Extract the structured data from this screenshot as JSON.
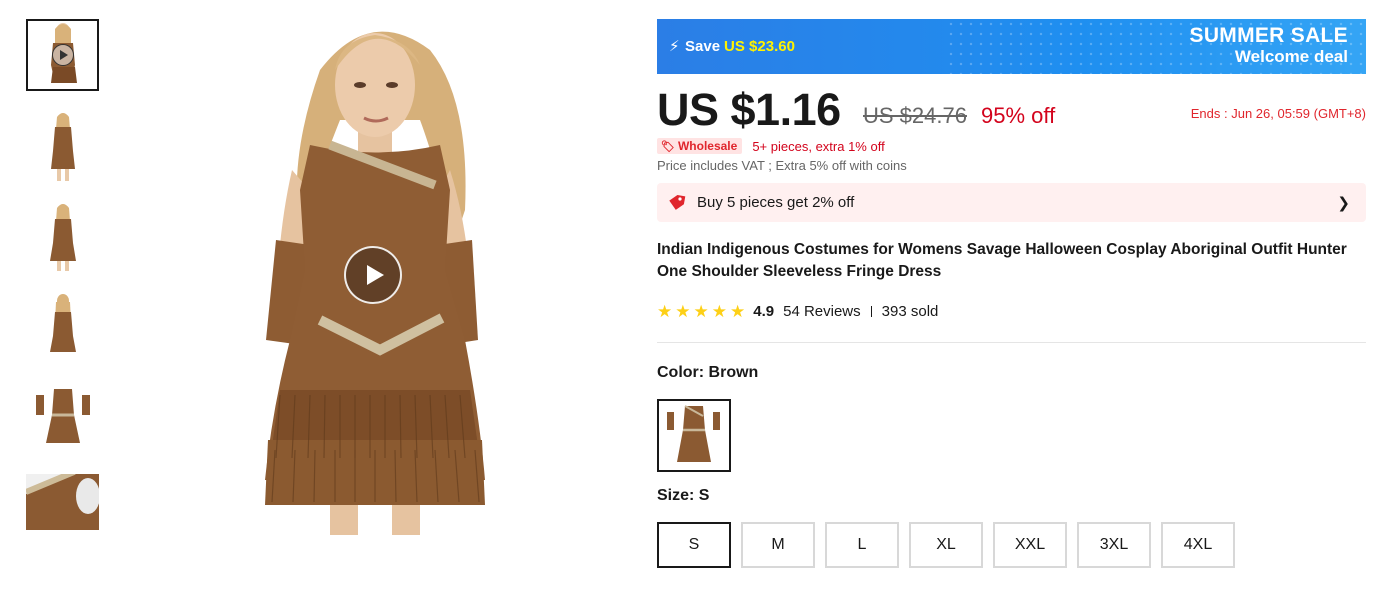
{
  "gallery": {
    "thumbnails": [
      "video-thumbnail",
      "front-view",
      "full-length-view",
      "back-view",
      "product-flat-lay",
      "shoulder-detail"
    ],
    "active_index": 0
  },
  "banner": {
    "save_prefix": "Save",
    "save_amount": "US $23.60",
    "title_line1": "SUMMER SALE",
    "title_line2": "Welcome deal",
    "bolt_icon": "lightning-icon"
  },
  "pricing": {
    "price": "US $1.16",
    "original_price": "US $24.76",
    "discount": "95% off",
    "ends": "Ends :  Jun 26, 05:59 (GMT+8)",
    "wholesale_badge": "Wholesale",
    "wholesale_text": "5+ pieces, extra 1% off",
    "vat_note": "Price includes VAT ; Extra 5% off with coins"
  },
  "promo": {
    "text": "Buy 5 pieces get 2% off",
    "icon": "price-tag-icon"
  },
  "product": {
    "title": "Indian Indigenous Costumes for Womens Savage Halloween Cosplay Aboriginal Outfit Hunter One Shoulder Sleeveless Fringe Dress",
    "rating": "4.9",
    "stars_filled": 5,
    "reviews": "54 Reviews",
    "sold": "393 sold"
  },
  "options": {
    "color_label": "Color: Brown",
    "size_label": "Size: S",
    "sizes": [
      "S",
      "M",
      "L",
      "XL",
      "XXL",
      "3XL",
      "4XL"
    ],
    "selected_size": "S"
  },
  "colors": {
    "accent_red": "#d3031c",
    "banner_blue": "#1f8ff0",
    "star": "#fdd017",
    "dress_brown": "#8b5a32"
  }
}
